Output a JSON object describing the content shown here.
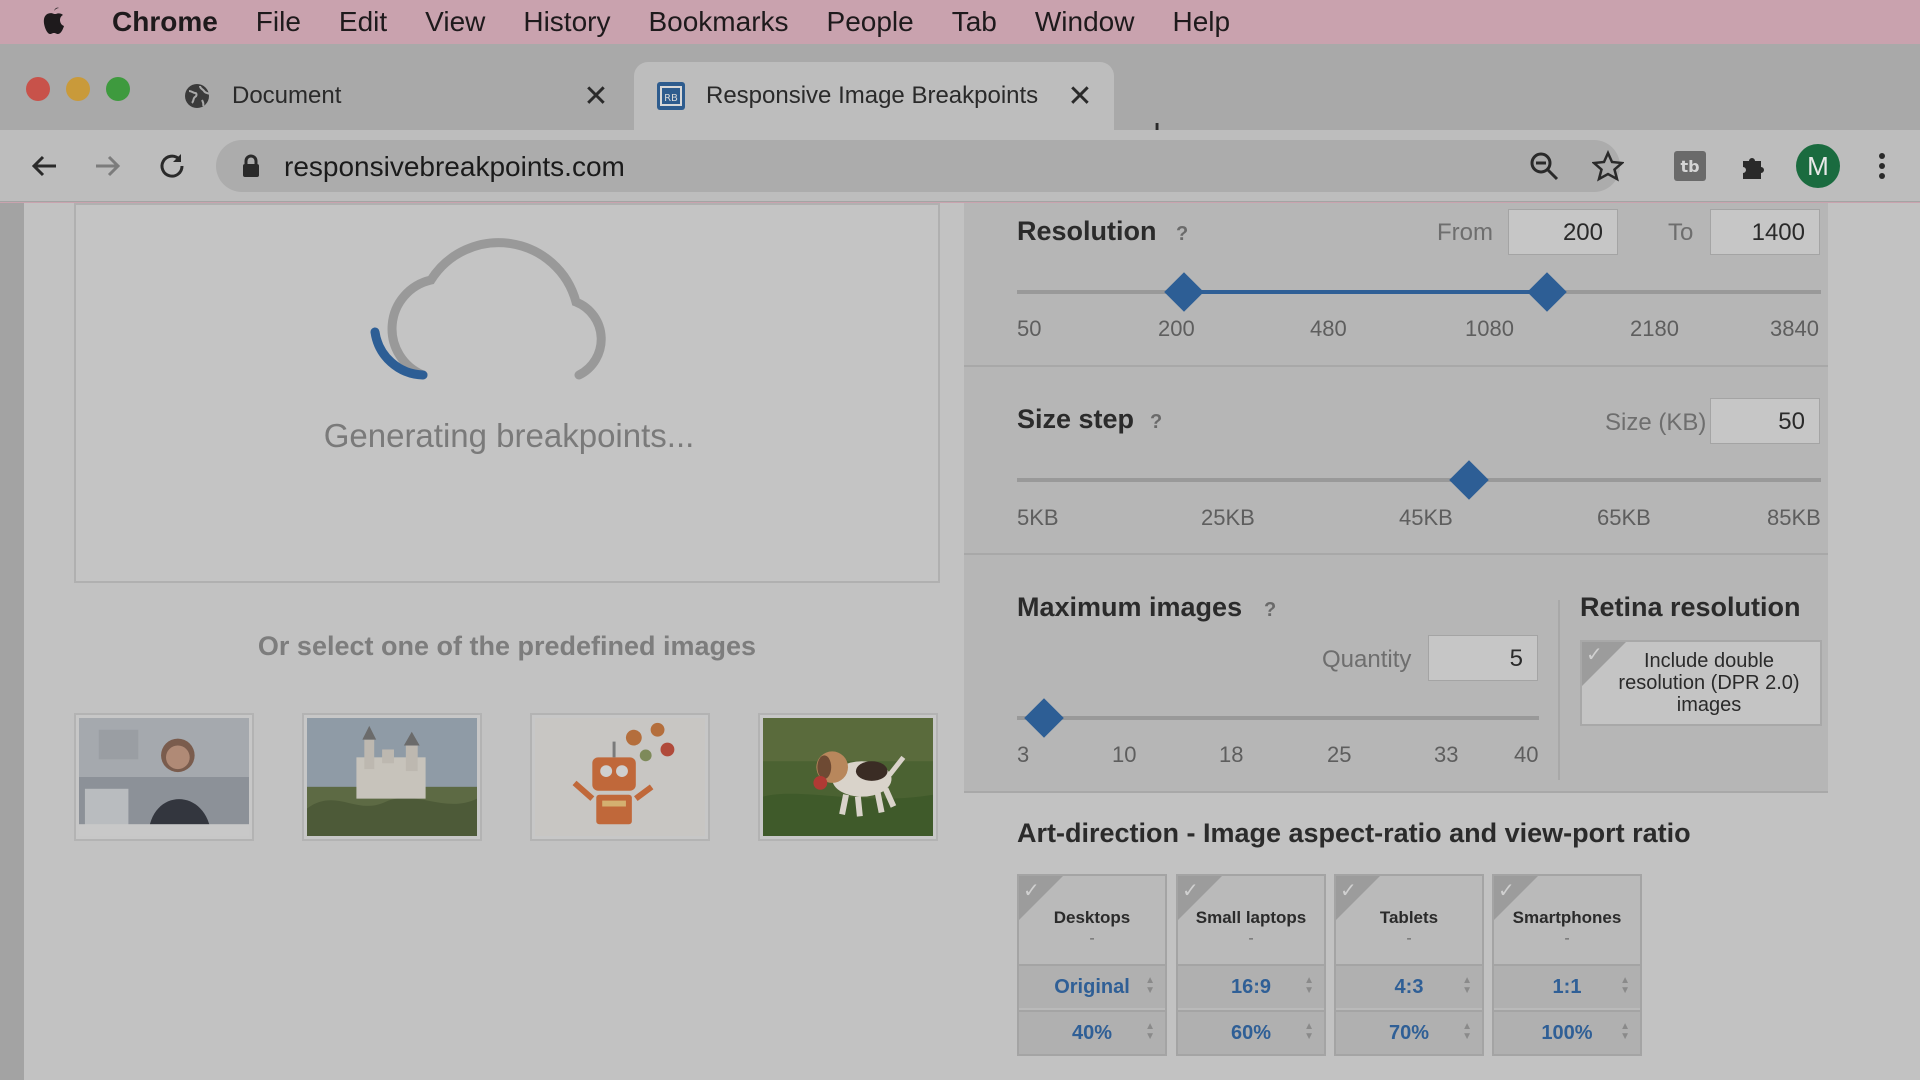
{
  "menubar": {
    "app": "Chrome",
    "items": [
      "File",
      "Edit",
      "View",
      "History",
      "Bookmarks",
      "People",
      "Tab",
      "Window",
      "Help"
    ]
  },
  "tabs": [
    {
      "title": "Document",
      "icon": "globe-icon"
    },
    {
      "title": "Responsive Image Breakpoints",
      "icon": "rb-favicon-icon"
    }
  ],
  "omnibox": {
    "url": "responsivebreakpoints.com"
  },
  "profile": {
    "initial": "M",
    "color": "#1a6b3f"
  },
  "upload": {
    "status": "Generating breakpoints..."
  },
  "predefined": {
    "title": "Or select one of the predefined images",
    "images": [
      "woman-at-laptop",
      "castle",
      "robot-with-flowers",
      "beagle-puppy"
    ]
  },
  "resolution": {
    "label": "Resolution",
    "help": "?",
    "from_label": "From",
    "from_value": "200",
    "to_label": "To",
    "to_value": "1400",
    "ticks": [
      "50",
      "200",
      "480",
      "1080",
      "2180",
      "3840"
    ]
  },
  "size_step": {
    "label": "Size step",
    "help": "?",
    "size_label": "Size (KB)",
    "size_value": "50",
    "ticks": [
      "5KB",
      "25KB",
      "45KB",
      "65KB",
      "85KB"
    ]
  },
  "max_images": {
    "label": "Maximum images",
    "help": "?",
    "quantity_label": "Quantity",
    "quantity_value": "5",
    "ticks": [
      "3",
      "10",
      "18",
      "25",
      "33",
      "40"
    ]
  },
  "retina": {
    "label": "Retina resolution",
    "checkbox_text": "Include double resolution (DPR 2.0) images",
    "checked": true
  },
  "art_direction": {
    "title": "Art-direction - Image aspect-ratio and view-port ratio",
    "devices": [
      {
        "name": "Desktops",
        "sub": "-",
        "ratio": "Original",
        "viewport": "40%"
      },
      {
        "name": "Small laptops",
        "sub": "-",
        "ratio": "16:9",
        "viewport": "60%"
      },
      {
        "name": "Tablets",
        "sub": "-",
        "ratio": "4:3",
        "viewport": "70%"
      },
      {
        "name": "Smartphones",
        "sub": "-",
        "ratio": "1:1",
        "viewport": "100%"
      }
    ]
  },
  "colors": {
    "accent": "#2d5e95",
    "menubar": "#c9a2ae",
    "close_red": "#c8524a",
    "minimize_yellow": "#c99a3a",
    "maximize_green": "#3e9a3e"
  }
}
